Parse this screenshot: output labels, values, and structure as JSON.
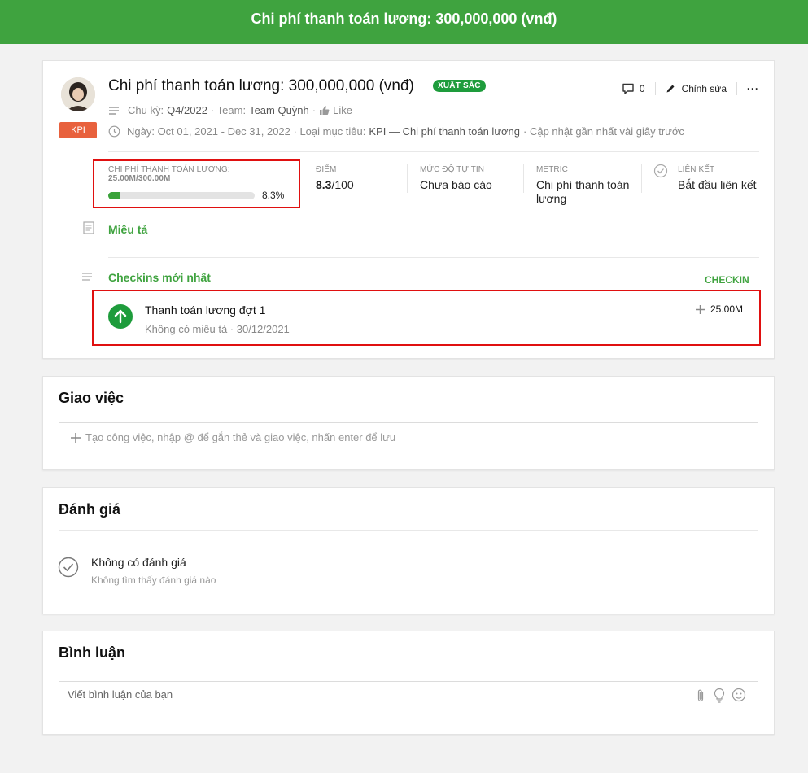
{
  "header": {
    "title": "Chi phí thanh toán lương: 300,000,000 (vnđ)"
  },
  "goal": {
    "title": "Chi phí thanh toán lương: 300,000,000 (vnđ)",
    "status_badge": "XUẤT SẮC",
    "type_badge": "KPI",
    "cycle_label": "Chu kỳ:",
    "cycle_value": "Q4/2022",
    "team_label": "· Team:",
    "team_value": "Team Quỳnh",
    "like_label": "Like",
    "date_text": "Ngày: Oct 01, 2021 - Dec 31, 2022 · Loại mục tiêu:",
    "goal_type_value": "KPI — Chi phí thanh toán lương",
    "updated_text": "· Cập nhật gần nhất vài giây trước",
    "comment_count": "0",
    "edit_label": "Chỉnh sửa",
    "more_label": "···"
  },
  "stats": {
    "progress_label": "CHI PHÍ THANH TOÁN LƯƠNG:",
    "progress_value_text": "25.00M/300.00M",
    "progress_percent_text": "8.3%",
    "progress_fraction": 0.083,
    "score_label": "ĐIỂM",
    "score_value": "8.3",
    "score_total": "/100",
    "confidence_label": "MỨC ĐỘ TỰ TIN",
    "confidence_value": "Chưa báo cáo",
    "metric_label": "METRIC",
    "metric_value": "Chi phí thanh toán lương",
    "link_label": "LIÊN KẾT",
    "link_value": "Bắt đầu liên kết"
  },
  "description": {
    "label": "Miêu tả"
  },
  "checkins": {
    "label": "Checkins mới nhất",
    "button": "CHECKIN",
    "items": [
      {
        "title": "Thanh toán lương đợt 1",
        "subtitle": "Không có miêu tả · 30/12/2021",
        "amount": "25.00M"
      }
    ]
  },
  "tasks": {
    "title": "Giao việc",
    "placeholder": "Tạo công việc, nhập @ để gắn thẻ và giao việc, nhấn enter để lưu"
  },
  "review": {
    "title": "Đánh giá",
    "empty_title": "Không có đánh giá",
    "empty_subtitle": "Không tìm thấy đánh giá nào"
  },
  "comments": {
    "title": "Bình luận",
    "placeholder": "Viết bình luận của bạn"
  },
  "colors": {
    "brand_green": "#3fa33f",
    "kpi_orange": "#e8613d",
    "highlight_red": "#e01010"
  }
}
